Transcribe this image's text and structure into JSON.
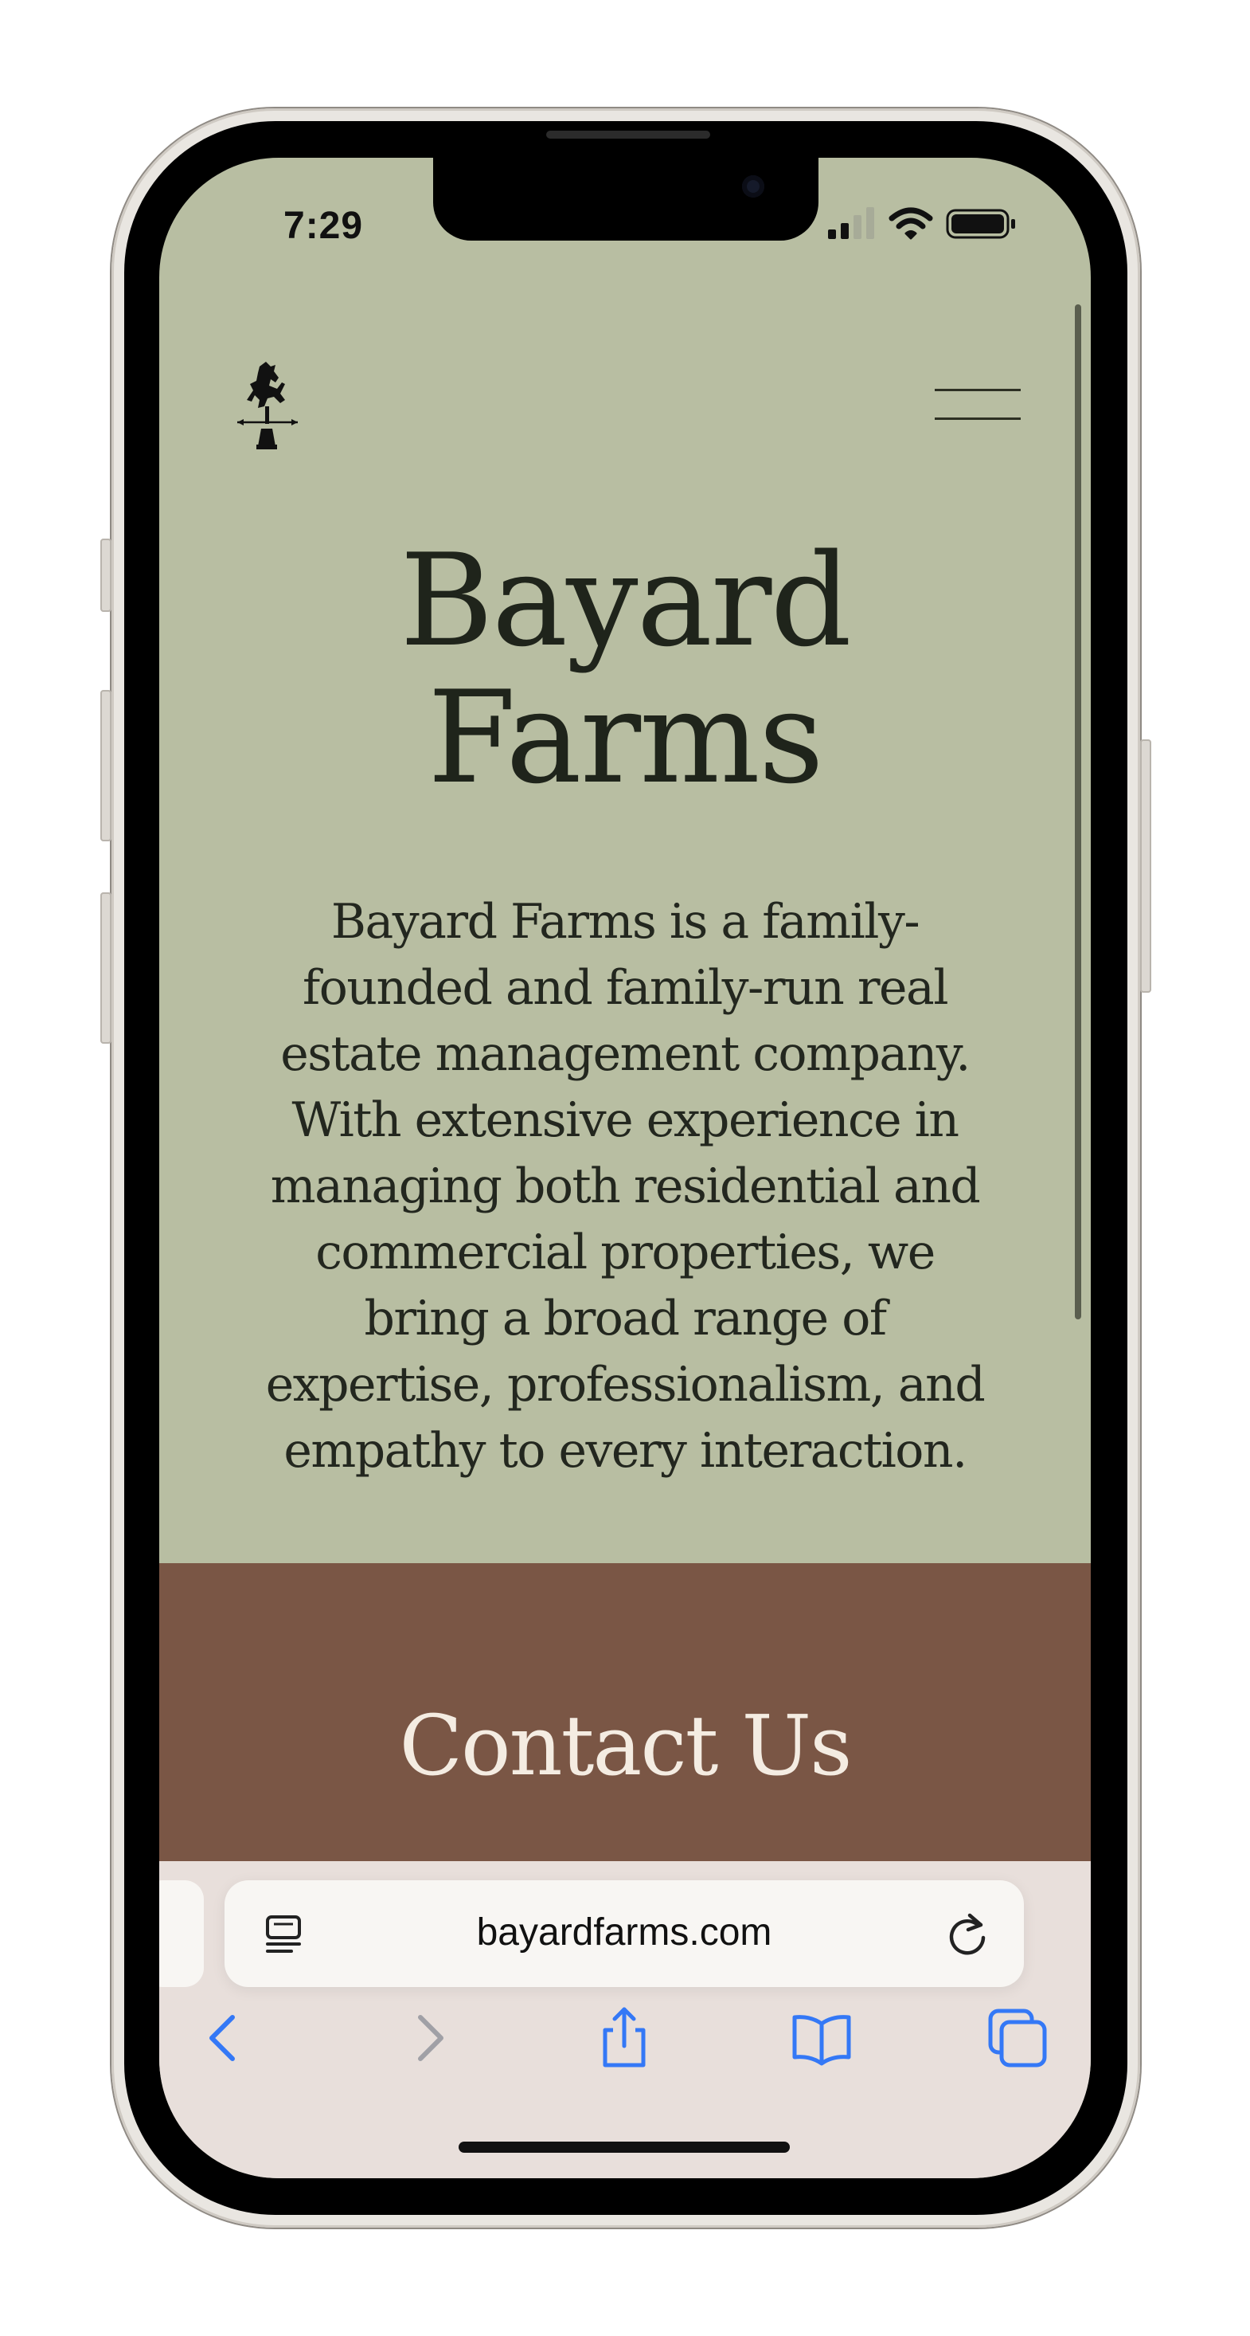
{
  "status_bar": {
    "time": "7:29",
    "icons": [
      "cellular-signal-icon",
      "wifi-icon",
      "battery-icon"
    ]
  },
  "site": {
    "logo_icon": "rearing-horse-weathervane-icon",
    "menu_icon": "hamburger-menu-icon",
    "hero": {
      "title_line1": "Bayard",
      "title_line2": "Farms",
      "description_lines": [
        "Bayard Farms is a family-",
        "founded and family-run real",
        "estate management company.",
        "With extensive experience in",
        "managing both residential and",
        "commercial properties, we",
        "bring a broad range of",
        "expertise, professionalism, and",
        "empathy to every interaction."
      ]
    },
    "contact": {
      "title": "Contact Us"
    },
    "colors": {
      "hero_background": "#b8bea2",
      "contact_background": "#7a5645",
      "text_dark": "#1f241b",
      "text_light": "#f4ece2"
    }
  },
  "browser": {
    "url": "bayardfarms.com",
    "reader_icon": "page-menu-icon",
    "reload_icon": "reload-icon",
    "toolbar": [
      "back-icon",
      "forward-icon",
      "share-icon",
      "bookmarks-icon",
      "tabs-icon"
    ],
    "accent_color": "#3478f6"
  }
}
